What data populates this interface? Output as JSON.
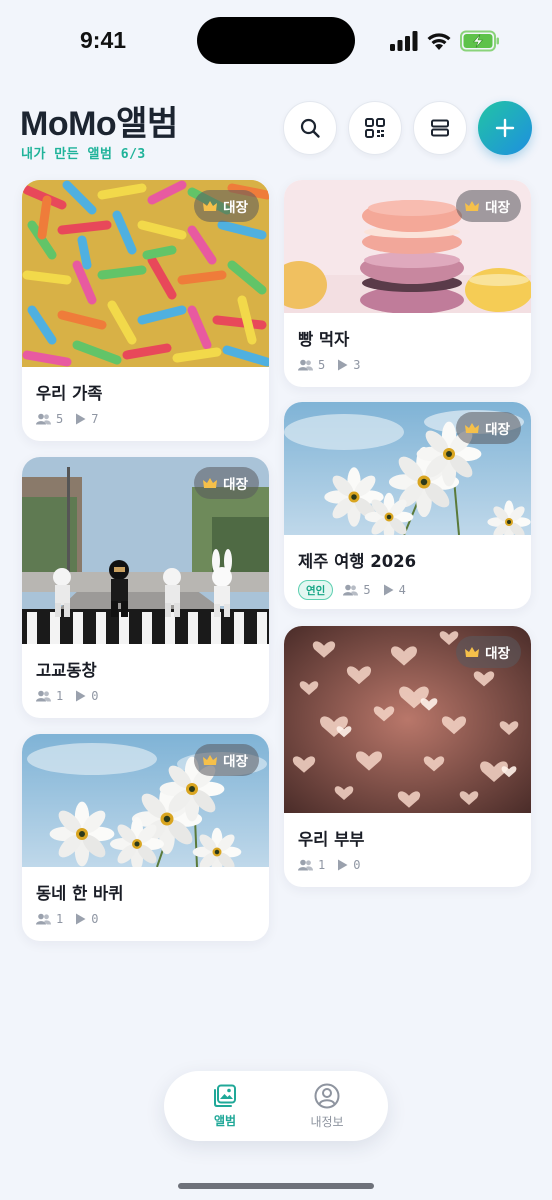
{
  "status_bar": {
    "time": "9:41"
  },
  "header": {
    "title": "MoMo앨범",
    "subtitle": "내가 만든 앨범 6/3"
  },
  "actions": [
    {
      "name": "search",
      "icon": "search-icon"
    },
    {
      "name": "qr",
      "icon": "qr-code-icon"
    },
    {
      "name": "layout",
      "icon": "layout-toggle-icon"
    },
    {
      "name": "create",
      "icon": "plus-icon"
    }
  ],
  "owner_badge_label": "대장",
  "albums": [
    {
      "title": "우리 가족",
      "members": "5",
      "videos": "7",
      "image": "gummy-candy"
    },
    {
      "title": "빵 먹자",
      "members": "5",
      "videos": "3",
      "image": "macarons"
    },
    {
      "title": "고교동창",
      "members": "1",
      "videos": "0",
      "image": "toy-figures-crosswalk"
    },
    {
      "title": "제주 여행 2026",
      "tag": "연인",
      "members": "5",
      "videos": "4",
      "image": "white-cosmos-flowers"
    },
    {
      "title": "동네 한 바퀴",
      "members": "1",
      "videos": "0",
      "image": "white-cosmos-flowers"
    },
    {
      "title": "우리 부부",
      "members": "1",
      "videos": "0",
      "image": "heart-bokeh"
    }
  ],
  "tabs": [
    {
      "label": "앨범",
      "icon": "album-image-icon",
      "active": true
    },
    {
      "label": "내정보",
      "icon": "profile-icon",
      "active": false
    }
  ],
  "colors": {
    "accent": "#20B39A",
    "primary_gradient_start": "#22C4A4",
    "primary_gradient_end": "#1E8FE0",
    "background": "#F2F5FB"
  }
}
